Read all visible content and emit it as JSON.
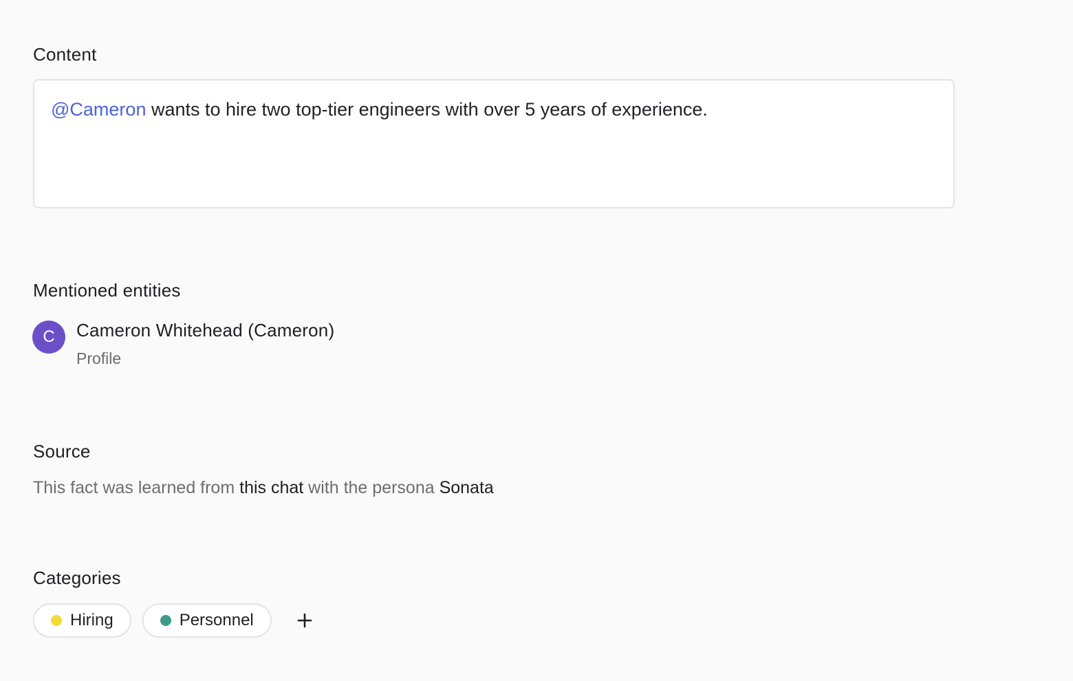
{
  "content": {
    "title": "Content",
    "mention": "@Cameron",
    "text": " wants to hire two top-tier engineers with over 5 years of experience."
  },
  "mentioned_entities": {
    "title": "Mentioned entities",
    "items": [
      {
        "initial": "C",
        "name": "Cameron Whitehead (Cameron)",
        "type": "Profile",
        "avatar_color": "#6a4fc8"
      }
    ]
  },
  "source": {
    "title": "Source",
    "prefix": "This fact was learned from ",
    "link_text": "this chat",
    "middle": " with the persona ",
    "persona": "Sonata"
  },
  "categories": {
    "title": "Categories",
    "items": [
      {
        "label": "Hiring",
        "color": "#f5d938"
      },
      {
        "label": "Personnel",
        "color": "#3f9a8a"
      }
    ],
    "add_icon": "plus-icon"
  }
}
